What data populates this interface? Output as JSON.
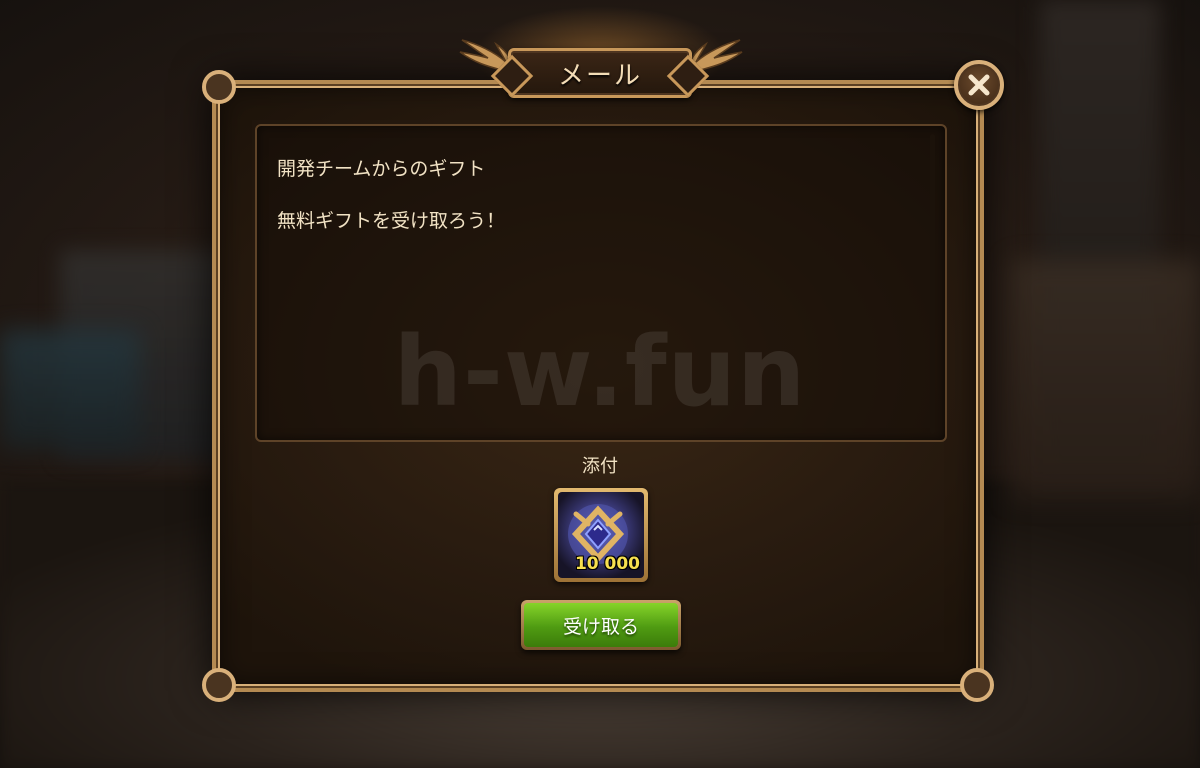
{
  "dialog": {
    "title": "メール",
    "close_icon": "close-x-icon",
    "accent_color": "#d9b07a"
  },
  "message": {
    "line1": "開発チームからのギフト",
    "line2": "無料ギフトを受け取ろう！"
  },
  "watermark": "h-w.fun",
  "attachments": {
    "label": "添付",
    "items": [
      {
        "icon": "emblem-badge-icon",
        "count": "10 000"
      }
    ]
  },
  "claim_button": {
    "label": "受け取る",
    "color": "#4f9b12"
  }
}
